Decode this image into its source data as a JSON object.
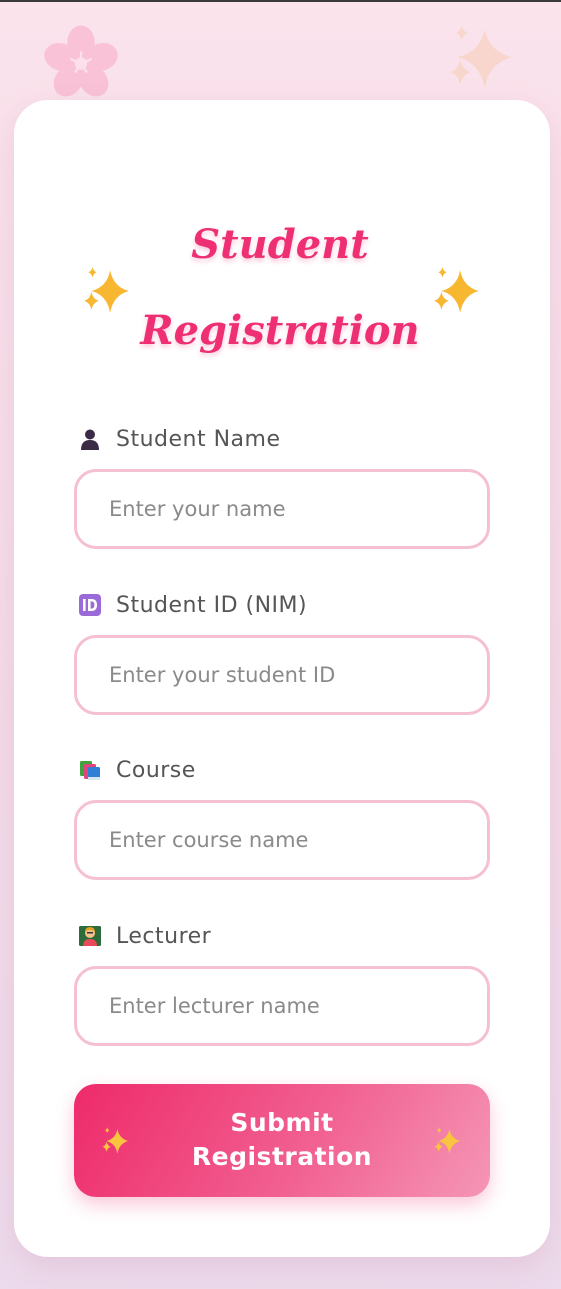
{
  "form": {
    "title_line1": "Student",
    "title_line2": "Registration",
    "fields": [
      {
        "label": "Student Name",
        "placeholder": "Enter your name",
        "icon": "person-silhouette-icon"
      },
      {
        "label": "Student ID (NIM)",
        "placeholder": "Enter your student ID",
        "icon": "id-badge-icon"
      },
      {
        "label": "Course",
        "placeholder": "Enter course name",
        "icon": "books-icon"
      },
      {
        "label": "Lecturer",
        "placeholder": "Enter lecturer name",
        "icon": "teacher-icon"
      }
    ],
    "submit_line1": "Submit",
    "submit_line2": "Registration"
  },
  "decorations": {
    "background_icons": [
      "cherry-blossom-icon",
      "sparkles-icon"
    ],
    "title_icons": [
      "sparkles-icon",
      "sparkles-icon"
    ],
    "button_icons": [
      "sparkles-icon",
      "sparkles-icon"
    ]
  },
  "colors": {
    "accent": "#ee2f74",
    "field_border": "#f5bfd4",
    "button_gradient_start": "#ee2a6a",
    "button_gradient_end": "#f596b6",
    "sparkle": "#f7b731"
  }
}
